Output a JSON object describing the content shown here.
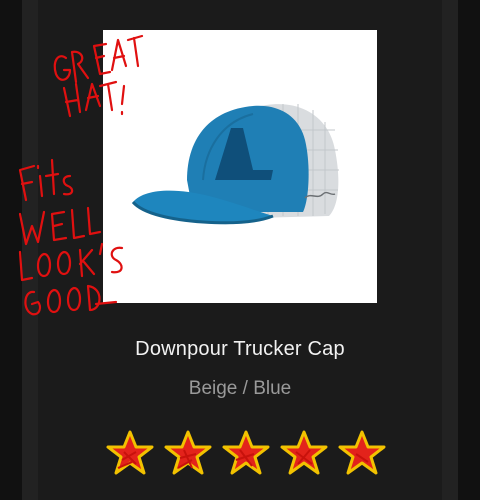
{
  "product": {
    "name": "Downpour Trucker Cap",
    "variant": "Beige / Blue"
  },
  "rating": {
    "stars": 5,
    "max": 5
  },
  "annotation": {
    "text": "GREAT HAT! Fits WELL LOOK'S GOOD",
    "color": "#e01010"
  },
  "colors": {
    "cap_front": "#1f7fb5",
    "cap_mesh": "#d9dcdf",
    "star_fill": "#e3231b",
    "star_outline": "#f2c200"
  }
}
